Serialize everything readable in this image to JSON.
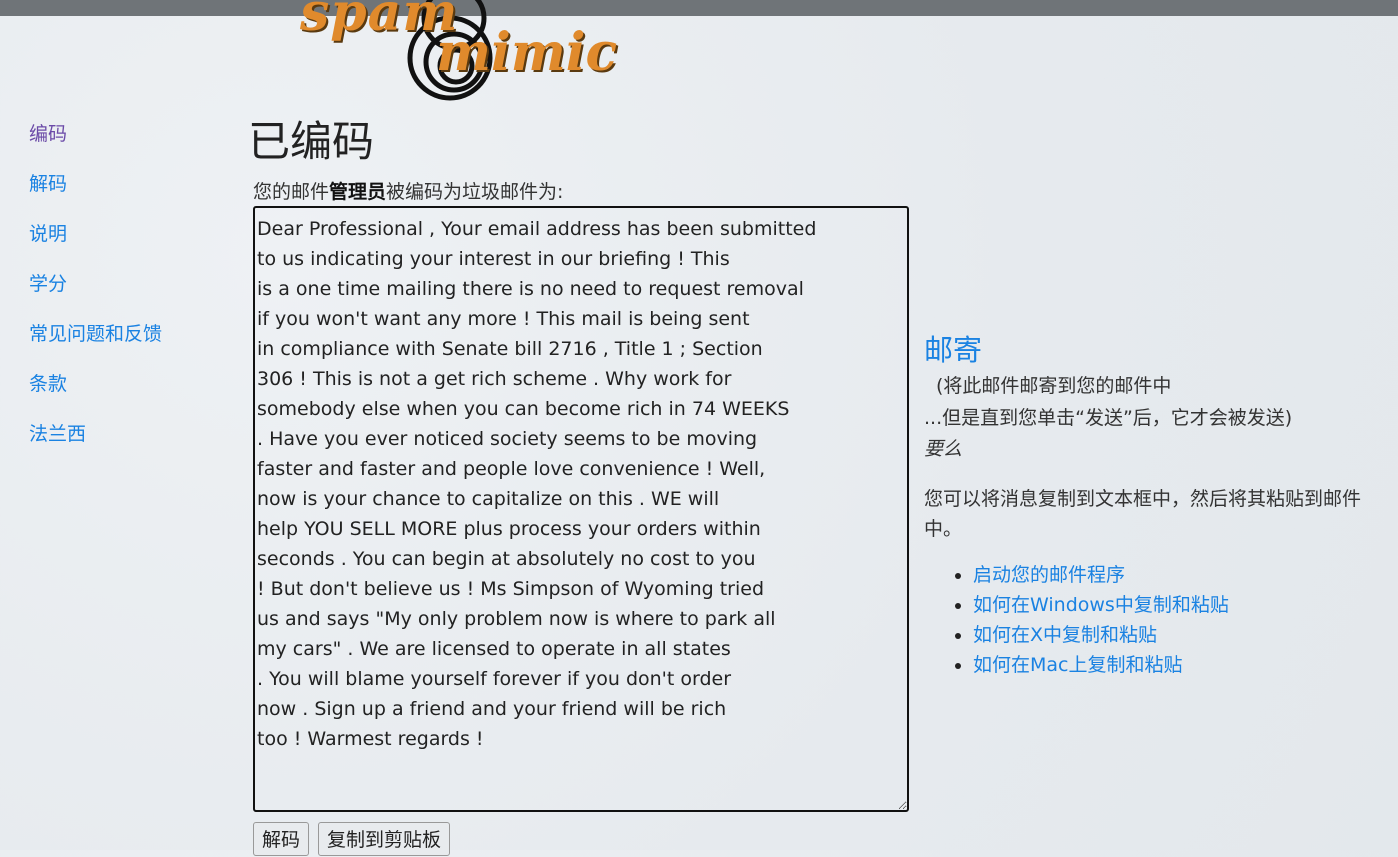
{
  "logo": {
    "word1": "spam",
    "word2": "mimic"
  },
  "nav": {
    "items": [
      {
        "label": "编码"
      },
      {
        "label": "解码"
      },
      {
        "label": "说明"
      },
      {
        "label": "学分"
      },
      {
        "label": "常见问题和反馈"
      },
      {
        "label": "条款"
      },
      {
        "label": "法兰西"
      }
    ]
  },
  "main": {
    "title": "已编码",
    "intro_prefix": "您的邮件",
    "intro_bold": "管理员",
    "intro_suffix": "被编码为垃圾邮件为:",
    "encoded_text": "Dear Professional , Your email address has been submitted\nto us indicating your interest in our briefing ! This\nis a one time mailing there is no need to request removal\nif you won't want any more ! This mail is being sent\nin compliance with Senate bill 2716 , Title 1 ; Section\n306 ! This is not a get rich scheme . Why work for\nsomebody else when you can become rich in 74 WEEKS\n. Have you ever noticed society seems to be moving\nfaster and faster and people love convenience ! Well,\nnow is your chance to capitalize on this . WE will\nhelp YOU SELL MORE plus process your orders within\nseconds . You can begin at absolutely no cost to you\n! But don't believe us ! Ms Simpson of Wyoming tried\nus and says \"My only problem now is where to park all\nmy cars\" . We are licensed to operate in all states\n. You will blame yourself forever if you don't order\nnow . Sign up a friend and your friend will be rich\ntoo ! Warmest regards !",
    "decode_button": "解码",
    "copy_button": "复制到剪贴板"
  },
  "mail": {
    "title": "邮寄",
    "line1": "(将此邮件邮寄到您的邮件中",
    "line2": "...但是直到您单击“发送”后，它才会被发送)",
    "or_label": "要么",
    "copy_text": "您可以将消息复制到文本框中，然后将其粘贴到邮件中。",
    "links": [
      {
        "label": "启动您的邮件程序"
      },
      {
        "label": "如何在Windows中复制和粘贴"
      },
      {
        "label": "如何在X中复制和粘贴"
      },
      {
        "label": "如何在Mac上复制和粘贴"
      }
    ]
  }
}
